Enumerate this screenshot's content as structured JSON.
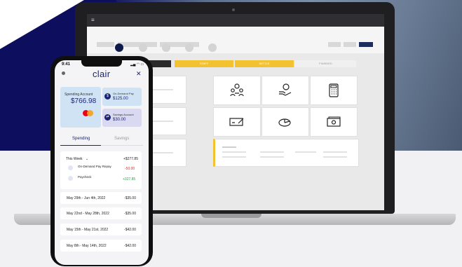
{
  "laptop": {
    "progress_steps": [
      "TS",
      "STAFF",
      "SETTLE",
      "FINISHED"
    ]
  },
  "phone": {
    "status_time": "9:41",
    "logo": "clair",
    "close_symbol": "✕",
    "spending_account": {
      "label": "Spending Account",
      "balance": "$766.98"
    },
    "on_demand_pay": {
      "label": "On-Demand Pay",
      "amount": "$125.00"
    },
    "savings_account": {
      "label": "Savings Account",
      "amount": "$30.00"
    },
    "tabs": [
      "Spending",
      "Savings"
    ],
    "this_week": {
      "label": "This Week",
      "total": "+$277.85",
      "transactions": [
        {
          "title": "On-Demand Pay Repay",
          "amount": "-50.00"
        },
        {
          "title": "Paycheck",
          "amount": "+327.85"
        }
      ]
    },
    "weeks": [
      {
        "range": "May 29th - Jun 4th, 2022",
        "amount": "-$35.00"
      },
      {
        "range": "May 22nd - May 28th, 2022",
        "amount": "-$35.00"
      },
      {
        "range": "May 15th - May 21st, 2022",
        "amount": "-$42.00"
      },
      {
        "range": "May 8th - May 14th, 2022",
        "amount": "-$42.00"
      }
    ]
  }
}
